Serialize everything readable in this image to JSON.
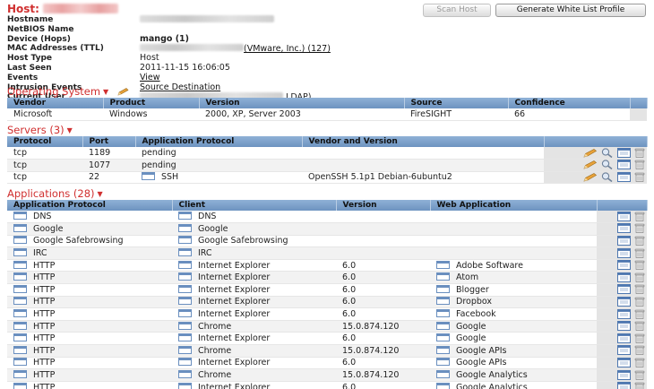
{
  "header": {
    "title": "Host:",
    "scan_label": "Scan Host",
    "whitelist_label": "Generate White List Profile"
  },
  "props": [
    {
      "label": "Hostname",
      "value": ""
    },
    {
      "label": "NetBIOS Name",
      "value": ""
    },
    {
      "label": "Device (Hops)",
      "value": "mango (1)"
    },
    {
      "label": "MAC Addresses (TTL)",
      "value": "(VMware, Inc.) (127)"
    },
    {
      "label": "Host Type",
      "value": "Host"
    },
    {
      "label": "Last Seen",
      "value": "2011-11-15 16:06:05"
    },
    {
      "label": "Events",
      "value": "View"
    },
    {
      "label": "Intrusion Events",
      "value": "Source Destination"
    },
    {
      "label": "Current User",
      "value": "LDAP)"
    }
  ],
  "os": {
    "title": "Operating System",
    "columns": [
      "Vendor",
      "Product",
      "Version",
      "Source",
      "Confidence"
    ],
    "rows": [
      [
        "Microsoft",
        "Windows",
        "2000, XP, Server 2003",
        "FireSIGHT",
        "66"
      ]
    ]
  },
  "servers": {
    "title": "Servers (3)",
    "columns": [
      "Protocol",
      "Port",
      "Application Protocol",
      "Vendor and Version"
    ],
    "rows": [
      [
        "tcp",
        "1189",
        "pending",
        ""
      ],
      [
        "tcp",
        "1077",
        "pending",
        ""
      ],
      [
        "tcp",
        "22",
        "SSH",
        "OpenSSH 5.1p1 Debian-6ubuntu2"
      ]
    ]
  },
  "applications": {
    "title": "Applications (28)",
    "columns": [
      "Application Protocol",
      "Client",
      "Version",
      "Web Application"
    ],
    "rows": [
      [
        "DNS",
        "DNS",
        "",
        ""
      ],
      [
        "Google",
        "Google",
        "",
        ""
      ],
      [
        "Google Safebrowsing",
        "Google Safebrowsing",
        "",
        ""
      ],
      [
        "IRC",
        "IRC",
        "",
        ""
      ],
      [
        "HTTP",
        "Internet Explorer",
        "6.0",
        "Adobe Software"
      ],
      [
        "HTTP",
        "Internet Explorer",
        "6.0",
        "Atom"
      ],
      [
        "HTTP",
        "Internet Explorer",
        "6.0",
        "Blogger"
      ],
      [
        "HTTP",
        "Internet Explorer",
        "6.0",
        "Dropbox"
      ],
      [
        "HTTP",
        "Internet Explorer",
        "6.0",
        "Facebook"
      ],
      [
        "HTTP",
        "Chrome",
        "15.0.874.120",
        "Google"
      ],
      [
        "HTTP",
        "Internet Explorer",
        "6.0",
        "Google"
      ],
      [
        "HTTP",
        "Chrome",
        "15.0.874.120",
        "Google APIs"
      ],
      [
        "HTTP",
        "Internet Explorer",
        "6.0",
        "Google APIs"
      ],
      [
        "HTTP",
        "Chrome",
        "15.0.874.120",
        "Google Analytics"
      ],
      [
        "HTTP",
        "Internet Explorer",
        "6.0",
        "Google Analytics"
      ]
    ]
  },
  "icons": {
    "edit": "pencil-icon",
    "search": "magnifier-icon",
    "view": "window-icon",
    "delete": "trash-icon"
  },
  "colors": {
    "section_red": "#d03030",
    "header_blue": "#7a9dc8"
  }
}
